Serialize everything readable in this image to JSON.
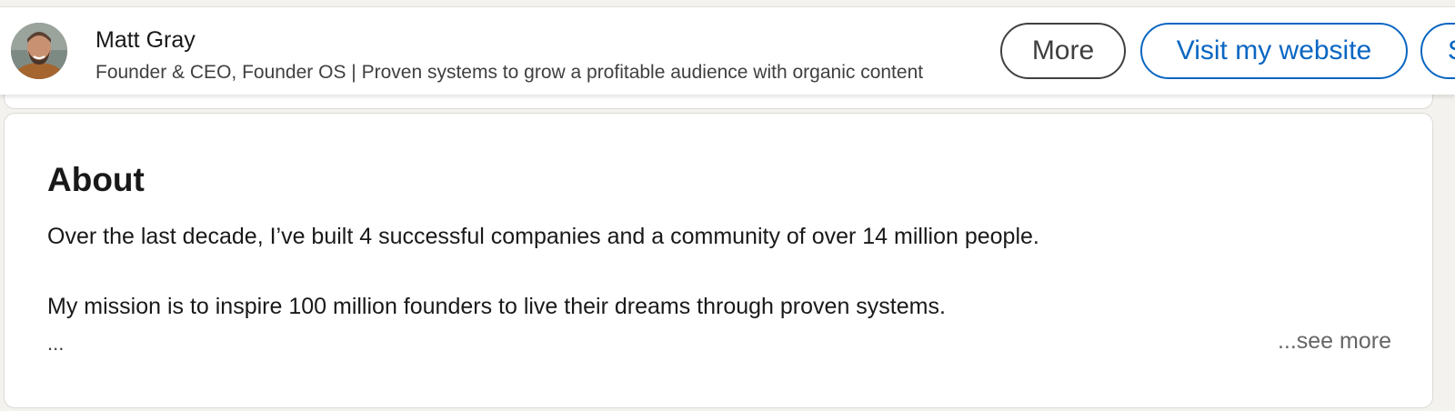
{
  "profile_bar": {
    "name": "Matt Gray",
    "headline": "Founder & CEO, Founder OS | Proven systems to grow a profitable audience with organic content",
    "more_label": "More",
    "website_label": "Visit my website",
    "partial_button_label": "S"
  },
  "about": {
    "title": "About",
    "paragraphs": [
      "Over the last decade, I’ve built 4 successful companies and a community of over 14 million people.",
      "My mission is to inspire 100 million founders to live their dreams through proven systems."
    ],
    "ellipsis": "...",
    "see_more_label": "...see more"
  },
  "colors": {
    "accent": "#0a66c2",
    "page_bg": "#f4f2ee",
    "card_bg": "#ffffff"
  }
}
